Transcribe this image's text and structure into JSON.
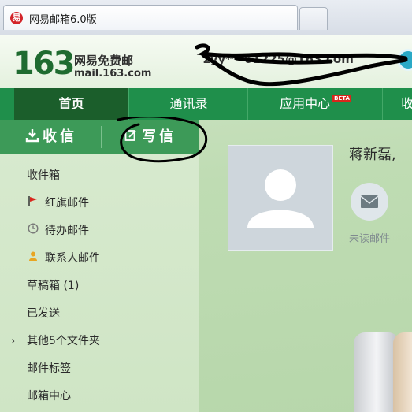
{
  "browser": {
    "tab_title": "网易邮箱6.0版",
    "favicon": "netease-logo-icon"
  },
  "header": {
    "logo_number": "163",
    "logo_cn": "网易免费邮",
    "logo_domain": "mail.163.com",
    "account": "zyy***61225@163.com",
    "exit_icon": "exit-icon"
  },
  "nav": {
    "items": [
      {
        "label": "首页"
      },
      {
        "label": "通讯录"
      },
      {
        "label": "应用中心",
        "badge": "BETA"
      },
      {
        "label": "收"
      }
    ]
  },
  "actions": {
    "receive_label": "收信",
    "compose_label": "写信"
  },
  "folders": [
    {
      "label": "收件箱"
    },
    {
      "label": "红旗邮件",
      "icon": "red-flag-icon"
    },
    {
      "label": "待办邮件",
      "icon": "clock-icon"
    },
    {
      "label": "联系人邮件",
      "icon": "contact-icon"
    },
    {
      "label": "草稿箱 (1)"
    },
    {
      "label": "已发送"
    },
    {
      "label": "其他5个文件夹",
      "icon": "chevron-right-icon"
    },
    {
      "label": "邮件标签"
    },
    {
      "label": "邮箱中心"
    }
  ],
  "main": {
    "greeting": "蒋新磊,",
    "unread_label": "未读邮件"
  },
  "colors": {
    "nav_green": "#1f8f4b",
    "nav_active": "#1b5e2b",
    "action_bar": "#3d9a58",
    "annotation_ink": "#000000"
  }
}
